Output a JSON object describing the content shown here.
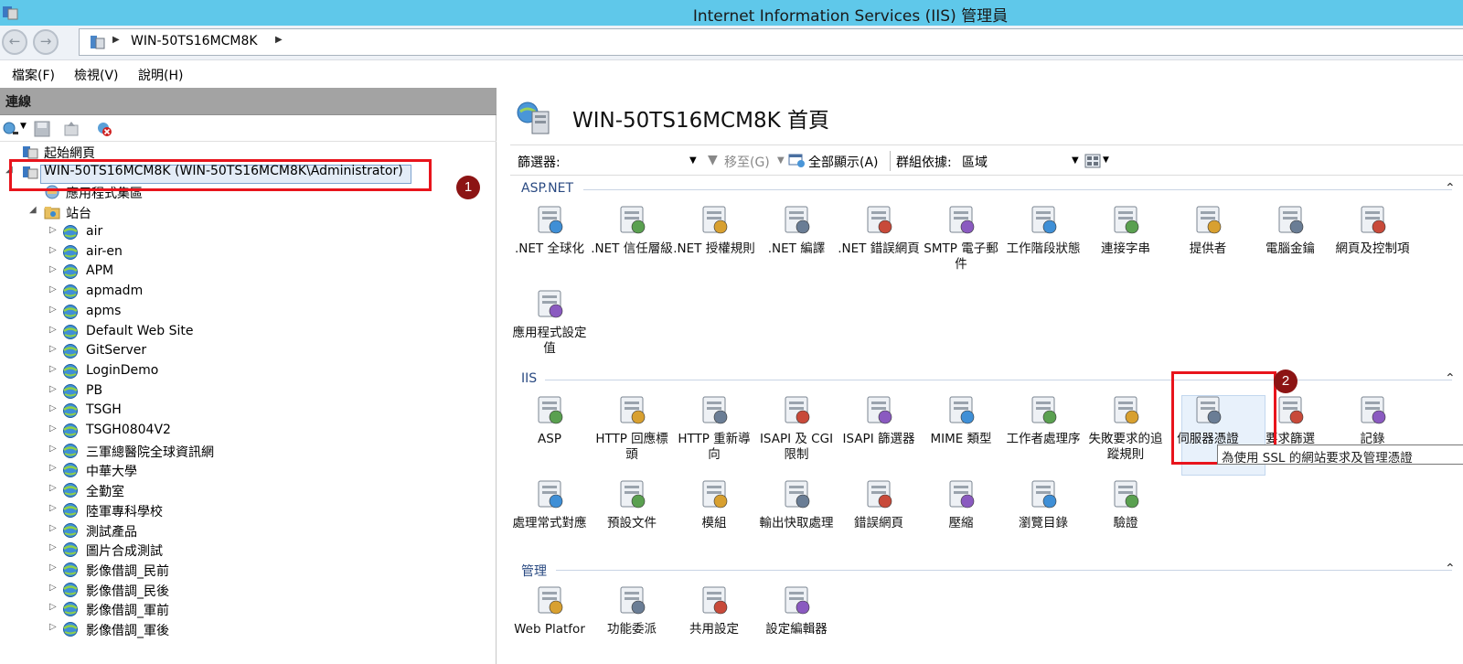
{
  "window": {
    "title": "Internet Information Services (IIS) 管理員"
  },
  "address": {
    "path": "WIN-50TS16MCM8K"
  },
  "menu": [
    "檔案(F)",
    "檢視(V)",
    "說明(H)"
  ],
  "connections": {
    "header": "連線",
    "nodes": [
      {
        "label": "起始網頁",
        "icon": "start-page-icon",
        "indent": 1
      },
      {
        "label": "WIN-50TS16MCM8K (WIN-50TS16MCM8K\\Administrator)",
        "icon": "server-icon",
        "indent": 1
      },
      {
        "label": "應用程式集區",
        "icon": "app-pool-icon",
        "indent": 2
      },
      {
        "label": "站台",
        "icon": "sites-folder-icon",
        "indent": 2
      },
      {
        "label": "air",
        "icon": "globe-icon",
        "indent": 3
      },
      {
        "label": "air-en",
        "icon": "globe-icon",
        "indent": 3
      },
      {
        "label": "APM",
        "icon": "globe-icon",
        "indent": 3
      },
      {
        "label": "apmadm",
        "icon": "globe-icon",
        "indent": 3
      },
      {
        "label": "apms",
        "icon": "globe-icon",
        "indent": 3
      },
      {
        "label": "Default Web Site",
        "icon": "globe-icon",
        "indent": 3
      },
      {
        "label": "GitServer",
        "icon": "globe-icon",
        "indent": 3
      },
      {
        "label": "LoginDemo",
        "icon": "globe-icon",
        "indent": 3
      },
      {
        "label": "PB",
        "icon": "globe-icon",
        "indent": 3
      },
      {
        "label": "TSGH",
        "icon": "globe-icon",
        "indent": 3
      },
      {
        "label": "TSGH0804V2",
        "icon": "globe-icon",
        "indent": 3
      },
      {
        "label": "三軍總醫院全球資訊網",
        "icon": "globe-icon",
        "indent": 3
      },
      {
        "label": "中華大學",
        "icon": "globe-icon",
        "indent": 3
      },
      {
        "label": "全勤室",
        "icon": "globe-icon",
        "indent": 3
      },
      {
        "label": "陸軍專科學校",
        "icon": "globe-icon",
        "indent": 3
      },
      {
        "label": "測試產品",
        "icon": "globe-icon",
        "indent": 3
      },
      {
        "label": "圖片合成測試",
        "icon": "globe-icon",
        "indent": 3
      },
      {
        "label": "影像借調_民前",
        "icon": "globe-icon",
        "indent": 3
      },
      {
        "label": "影像借調_民後",
        "icon": "globe-icon",
        "indent": 3
      },
      {
        "label": "影像借調_軍前",
        "icon": "globe-icon",
        "indent": 3
      },
      {
        "label": "影像借調_軍後",
        "icon": "globe-icon",
        "indent": 3
      }
    ]
  },
  "annotations": {
    "badge1": "1",
    "badge2": "2"
  },
  "home": {
    "title": "WIN-50TS16MCM8K 首頁",
    "filter": {
      "label": "篩選器:",
      "goto": "移至(G)",
      "show_all": "全部顯示(A)",
      "group_by_label": "群組依據:",
      "group_by_value": "區域"
    },
    "sections": [
      {
        "name": "ASP.NET",
        "items": [
          {
            "label": ".NET 全球化",
            "icon": "globe-icon"
          },
          {
            "label": ".NET 信任層級",
            "icon": "trust-check-icon"
          },
          {
            "label": ".NET 授權規則",
            "icon": "lock-document-icon"
          },
          {
            "label": ".NET 編譯",
            "icon": "compile-stack-icon"
          },
          {
            "label": ".NET 錯誤網頁",
            "icon": "error-page-404-icon"
          },
          {
            "label": "SMTP 電子郵件",
            "icon": "smtp-email-icon"
          },
          {
            "label": "工作階段狀態",
            "icon": "session-state-icon"
          },
          {
            "label": "連接字串",
            "icon": "connection-string-icon"
          },
          {
            "label": "提供者",
            "icon": "providers-icon"
          },
          {
            "label": "電腦金鑰",
            "icon": "machine-key-icon"
          },
          {
            "label": "網頁及控制項",
            "icon": "pages-controls-icon"
          },
          {
            "label": "應用程式設定值",
            "icon": "app-settings-icon"
          }
        ]
      },
      {
        "name": "IIS",
        "items": [
          {
            "label": "ASP",
            "icon": "asp-icon"
          },
          {
            "label": "HTTP 回應標頭",
            "icon": "http-response-headers-icon"
          },
          {
            "label": "HTTP 重新導向",
            "icon": "http-redirect-icon"
          },
          {
            "label": "ISAPI 及 CGI 限制",
            "icon": "isapi-cgi-icon"
          },
          {
            "label": "ISAPI 篩選器",
            "icon": "isapi-filter-icon"
          },
          {
            "label": "MIME 類型",
            "icon": "mime-types-icon"
          },
          {
            "label": "工作者處理序",
            "icon": "worker-process-icon"
          },
          {
            "label": "失敗要求的追蹤規則",
            "icon": "failed-request-tracing-icon"
          },
          {
            "label": "伺服器憑證",
            "icon": "server-certificates-icon"
          },
          {
            "label": "要求篩選",
            "icon": "request-filtering-icon"
          },
          {
            "label": "記錄",
            "icon": "logging-icon"
          },
          {
            "label": "處理常式對應",
            "icon": "handler-mappings-icon"
          },
          {
            "label": "預設文件",
            "icon": "default-document-icon"
          },
          {
            "label": "模組",
            "icon": "modules-icon"
          },
          {
            "label": "輸出快取處理",
            "icon": "output-caching-icon"
          },
          {
            "label": "錯誤網頁",
            "icon": "error-pages-icon"
          },
          {
            "label": "壓縮",
            "icon": "compression-icon"
          },
          {
            "label": "瀏覽目錄",
            "icon": "directory-browsing-icon"
          },
          {
            "label": "驗證",
            "icon": "authentication-icon"
          }
        ]
      },
      {
        "name": "管理",
        "items": [
          {
            "label": "Web Platfor",
            "icon": "web-platform-installer-icon"
          },
          {
            "label": "功能委派",
            "icon": "feature-delegation-icon"
          },
          {
            "label": "共用設定",
            "icon": "shared-configuration-icon"
          },
          {
            "label": "設定編輯器",
            "icon": "configuration-editor-icon"
          }
        ]
      }
    ],
    "tooltip": "為使用 SSL 的網站要求及管理憑證"
  }
}
